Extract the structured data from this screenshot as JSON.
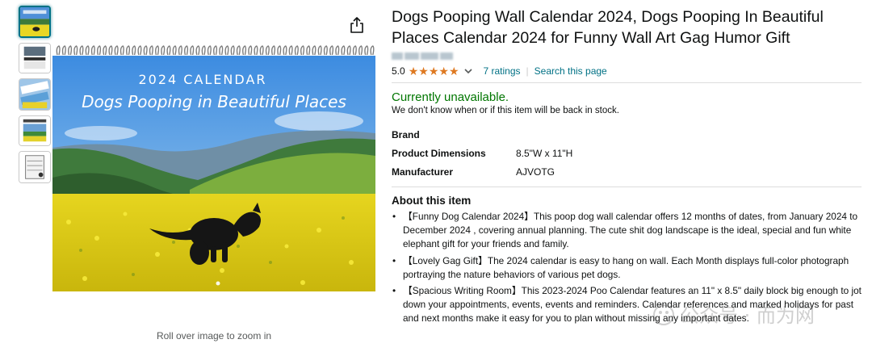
{
  "product": {
    "title": "Dogs Pooping Wall Calendar 2024, Dogs Pooping In Beautiful Places Calendar 2024 for Funny Wall Art Gag Humor Gift",
    "rating": "5.0",
    "rating_stars": 5,
    "ratings_count": "7 ratings",
    "search_link": "Search this page",
    "separator": "|"
  },
  "availability": {
    "status": "Currently unavailable.",
    "note": "We don't know when or if this item will be back in stock."
  },
  "specs": [
    {
      "key": "Brand",
      "value": ""
    },
    {
      "key": "Product Dimensions",
      "value": "8.5\"W x 11\"H"
    },
    {
      "key": "Manufacturer",
      "value": "AJVOTG"
    }
  ],
  "about": {
    "heading": "About this item",
    "bullets": [
      "【Funny Dog Calendar 2024】This poop dog wall calendar offers 12 months of dates, from January 2024 to December 2024 , covering annual planning. The cute shit dog landscape is the ideal, special and fun white elephant gift for your friends and family.",
      "【Lovely Gag Gift】The 2024 calendar is easy to hang on wall. Each Month displays full-color photograph portraying the nature behaviors of various pet dogs.",
      "【Spacious Writing Room】This 2023-2024 Poo Calendar features an 11\" x 8.5\" daily block big enough to jot down your appointments, events, events and reminders. Calendar references and marked holidays for past and next months make it easy for you to plan without missing any important dates."
    ]
  },
  "image": {
    "calendar_year_text": "2024 CALENDAR",
    "calendar_subtitle": "Dogs Pooping in Beautiful Places",
    "zoom_hint": "Roll over image to zoom in"
  },
  "watermark": {
    "text": "公众号 · 而为网"
  },
  "colors": {
    "link": "#007185",
    "available_green": "#007600",
    "star": "#de7921",
    "thumb_active_border": "#007185"
  },
  "icons": [
    "share-icon",
    "star-icon",
    "chevron-down-icon"
  ]
}
